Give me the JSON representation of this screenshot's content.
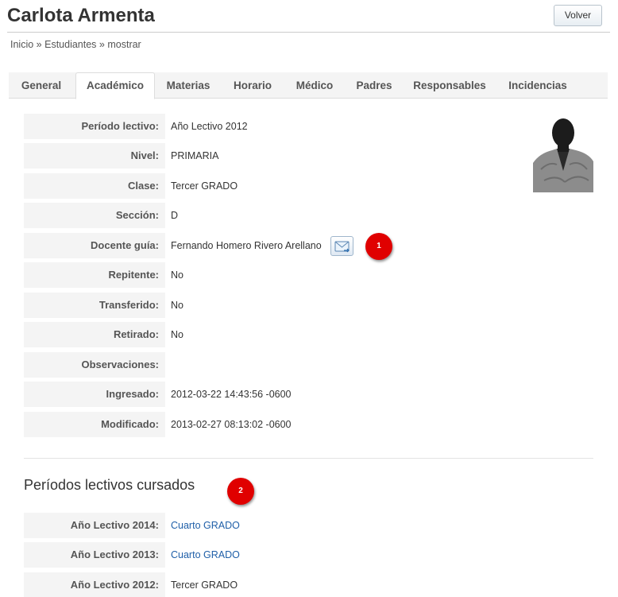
{
  "page": {
    "title": "Carlota Armenta",
    "back_label": "Volver"
  },
  "breadcrumb": {
    "items": [
      "Inicio",
      "Estudiantes",
      "mostrar"
    ],
    "separator": "»"
  },
  "tabs": [
    {
      "label": "General",
      "active": false
    },
    {
      "label": "Académico",
      "active": true
    },
    {
      "label": "Materias",
      "active": false
    },
    {
      "label": "Horario",
      "active": false
    },
    {
      "label": "Médico",
      "active": false
    },
    {
      "label": "Padres",
      "active": false
    },
    {
      "label": "Responsables",
      "active": false
    },
    {
      "label": "Incidencias",
      "active": false
    }
  ],
  "academic": {
    "fields": [
      {
        "label": "Período lectivo:",
        "value": "Año Lectivo 2012"
      },
      {
        "label": "Nivel:",
        "value": "PRIMARIA"
      },
      {
        "label": "Clase:",
        "value": "Tercer GRADO"
      },
      {
        "label": "Sección:",
        "value": "D"
      },
      {
        "label": "Docente guía:",
        "value": "Fernando Homero Rivero Arellano"
      },
      {
        "label": "Repitente:",
        "value": "No"
      },
      {
        "label": "Transferido:",
        "value": "No"
      },
      {
        "label": "Retirado:",
        "value": "No"
      },
      {
        "label": "Observaciones:",
        "value": ""
      },
      {
        "label": "Ingresado:",
        "value": "2012-03-22 14:43:56 -0600"
      },
      {
        "label": "Modificado:",
        "value": "2013-02-27 08:13:02 -0600"
      }
    ],
    "mail_icon": "envelope-icon",
    "photo_icon": "student-photo"
  },
  "markers": [
    "1",
    "2"
  ],
  "periods": {
    "title": "Períodos lectivos cursados",
    "items": [
      {
        "label": "Año Lectivo 2014:",
        "value": "Cuarto GRADO",
        "link": true
      },
      {
        "label": "Año Lectivo 2013:",
        "value": "Cuarto GRADO",
        "link": true
      },
      {
        "label": "Año Lectivo 2012:",
        "value": "Tercer GRADO",
        "link": false
      }
    ]
  },
  "colors": {
    "marker": "#e00000",
    "link": "#1f5fa8",
    "label_bg": "#f4f4f4"
  }
}
